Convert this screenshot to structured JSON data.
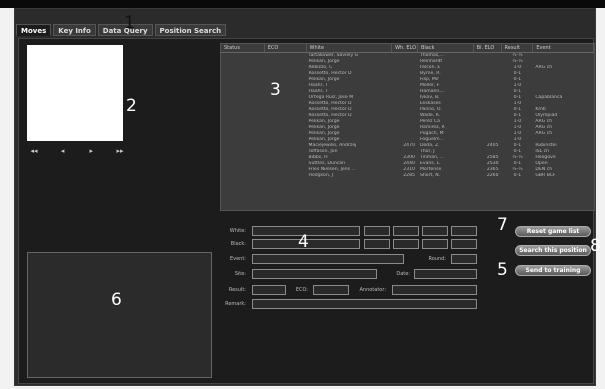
{
  "tabs": [
    "Moves",
    "Key Info",
    "Data Query",
    "Position Search"
  ],
  "nav": [
    "◂◂",
    "◂",
    "▸",
    "▸▸"
  ],
  "table": {
    "columns": [
      "Status",
      "ECO",
      "White",
      "Wh. ELO",
      "Black",
      "Bl. ELO",
      "Result",
      "Event"
    ],
    "rows": [
      [
        "",
        "",
        "Tartakower, Saviely G",
        "",
        "Thomas,...",
        "",
        "½-½",
        ""
      ],
      [
        "",
        "",
        "Pelikan, Jorge",
        "",
        "Reinhardt",
        "",
        "½-½",
        ""
      ],
      [
        "",
        "",
        "Rebizzo, C",
        "",
        "Falcon, E",
        "",
        "1-0",
        "ARG ch"
      ],
      [
        "",
        "",
        "Rossetto, Hector D",
        "",
        "Byrne, R.",
        "",
        "0-1",
        ""
      ],
      [
        "",
        "",
        "Pelikan, Jorge",
        "",
        "Filip, Mir",
        "",
        "0-1",
        ""
      ],
      [
        "",
        "",
        "Haahr, T",
        "",
        "Moller, F",
        "",
        "1-0",
        ""
      ],
      [
        "",
        "",
        "Haahr, T",
        "",
        "Hamann,...",
        "",
        "0-1",
        ""
      ],
      [
        "",
        "",
        "Ortega Ruiz, Jose M",
        "",
        "Ivkov, B.",
        "",
        "0-1",
        "Capablancа"
      ],
      [
        "",
        "",
        "Rossetto, Hector D",
        "",
        "Eliskases",
        "",
        "1-0",
        ""
      ],
      [
        "",
        "",
        "Rossetto, Hector D",
        "",
        "Panno, O.",
        "",
        "0-1",
        "Kmb"
      ],
      [
        "",
        "",
        "Rossetto, Hector D",
        "",
        "Wade, R.",
        "",
        "0-1",
        "Olympiad"
      ],
      [
        "",
        "",
        "Pelikan, Jorge",
        "",
        "Perez Ca",
        "",
        "1-0",
        "ARG ch"
      ],
      [
        "",
        "",
        "Pelikan, Jorge",
        "",
        "Ramirez, R",
        "",
        "1-0",
        "ARG ch"
      ],
      [
        "",
        "",
        "Pelikan, Jorge",
        "",
        "Pugach, M",
        "",
        "1-0",
        "ARG ch"
      ],
      [
        "",
        "",
        "Pelikan, Jorge",
        "",
        "Foguelm...",
        "",
        "1-0",
        ""
      ],
      [
        "",
        "",
        "Maciejewski, Andrzej",
        "2470",
        "Doda, Z.",
        "2405",
        "0-1",
        "Rubinstei"
      ],
      [
        "",
        "",
        "Toffason, Jon",
        "",
        "Thor, J",
        "",
        "0-1",
        "ISL ch"
      ],
      [
        "",
        "",
        "Bibbs, H",
        "2300",
        "Tinman, ...",
        "2585",
        "½-½",
        "Hoogove"
      ],
      [
        "",
        "",
        "Suttles, Duncan",
        "2440",
        "Evans, L.",
        "2530",
        "0-1",
        "Open"
      ],
      [
        "",
        "",
        "Fries Nielsen, Jens ...",
        "2310",
        "Mortense",
        "2365",
        "½-½",
        "DEN ch"
      ],
      [
        "",
        "",
        "Hodgson, J",
        "2285",
        "Short, N.",
        "2260",
        "0-1",
        "GBR BCF"
      ]
    ]
  },
  "form": {
    "white_label": "White:",
    "black_label": "Black:",
    "event_label": "Event:",
    "round_label": "Round:",
    "site_label": "Site:",
    "date_label": "Date:",
    "result_label": "Result:",
    "eco_label": "ECO:",
    "annotator_label": "Annotator:",
    "remark_label": "Remark:"
  },
  "buttons": {
    "reset": "Reset game list",
    "search": "Search this position",
    "send": "Send to training"
  },
  "callouts": [
    "1",
    "2",
    "3",
    "4",
    "5",
    "6",
    "7",
    "8"
  ]
}
